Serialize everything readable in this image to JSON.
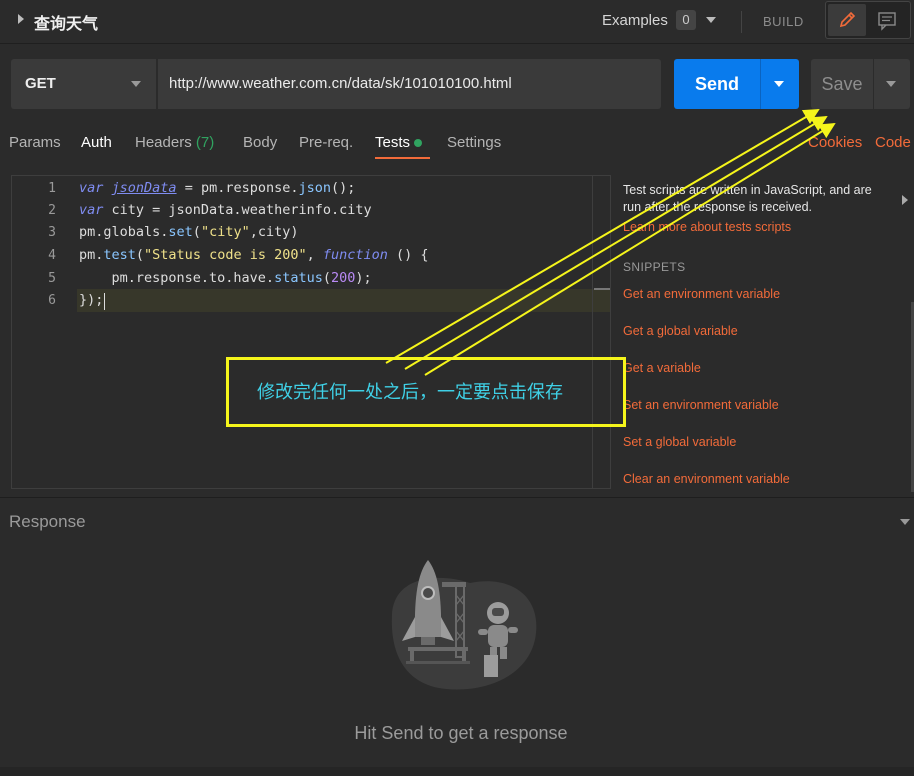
{
  "header": {
    "title": "查询天气",
    "examples_label": "Examples",
    "examples_count": "0",
    "build_label": "BUILD"
  },
  "request": {
    "method": "GET",
    "url": "http://www.weather.com.cn/data/sk/101010100.html",
    "send_label": "Send",
    "save_label": "Save"
  },
  "tabs": {
    "params": "Params",
    "auth": "Auth",
    "headers": "Headers",
    "headers_count": "(7)",
    "body": "Body",
    "prereq": "Pre-req.",
    "tests": "Tests",
    "settings": "Settings",
    "cookies": "Cookies",
    "code": "Code"
  },
  "editor": {
    "line_numbers": [
      "1",
      "2",
      "3",
      "4",
      "5",
      "6"
    ]
  },
  "snippets_panel": {
    "description": "Test scripts are written in JavaScript, and are run after the response is received.",
    "learn_more": "Learn more about tests scripts",
    "heading": "SNIPPETS",
    "items": [
      "Get an environment variable",
      "Get a global variable",
      "Get a variable",
      "Set an environment variable",
      "Set a global variable",
      "Clear an environment variable"
    ]
  },
  "response": {
    "heading": "Response",
    "hint": "Hit Send to get a response"
  },
  "annotation": {
    "text": "修改完任何一处之后，一定要点击保存",
    "box_color": "#f5f51b",
    "text_color": "#3fd0e6"
  },
  "colors": {
    "accent_orange": "#f26b3a",
    "send_blue": "#097bed",
    "success_green": "#30a360"
  }
}
